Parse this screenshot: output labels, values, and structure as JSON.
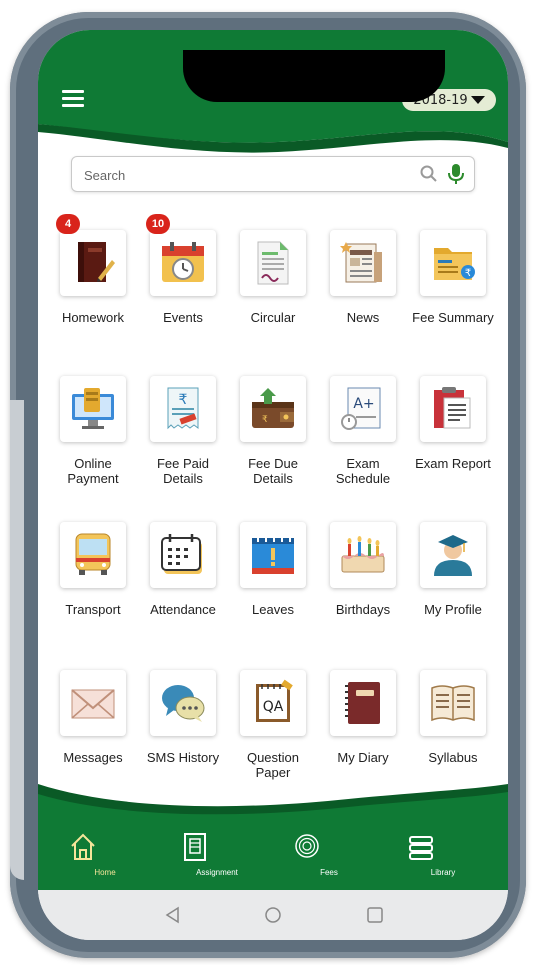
{
  "header": {
    "year": "2018-19"
  },
  "search": {
    "placeholder": "Search"
  },
  "tiles": [
    {
      "label": "Homework",
      "badge": "4",
      "icon": "homework-book-icon"
    },
    {
      "label": "Events",
      "badge": "10",
      "icon": "calendar-clock-icon"
    },
    {
      "label": "Circular",
      "icon": "circular-document-icon"
    },
    {
      "label": "News",
      "icon": "newspaper-icon"
    },
    {
      "label": "Fee Summary",
      "icon": "fee-summary-icon"
    },
    {
      "label": "Online\nPayment",
      "icon": "online-payment-icon"
    },
    {
      "label": "Fee Paid\nDetails",
      "icon": "rupee-receipt-icon"
    },
    {
      "label": "Fee Due\nDetails",
      "icon": "wallet-icon"
    },
    {
      "label": "Exam\nSchedule",
      "icon": "exam-grade-icon",
      "grade": "A+"
    },
    {
      "label": "Exam Report",
      "icon": "clipboard-report-icon"
    },
    {
      "label": "Transport",
      "icon": "bus-icon"
    },
    {
      "label": "Attendance",
      "icon": "attendance-calendar-icon"
    },
    {
      "label": "Leaves",
      "icon": "leave-calendar-icon"
    },
    {
      "label": "Birthdays",
      "icon": "birthday-cake-icon"
    },
    {
      "label": "My Profile",
      "icon": "graduate-profile-icon"
    },
    {
      "label": "Messages",
      "icon": "envelope-icon"
    },
    {
      "label": "SMS History",
      "icon": "chat-bubbles-icon"
    },
    {
      "label": "Question\nPaper",
      "icon": "question-paper-icon",
      "qa": "QA"
    },
    {
      "label": "My Diary",
      "icon": "diary-icon"
    },
    {
      "label": "Syllabus",
      "icon": "open-book-icon"
    }
  ],
  "bottom_nav": [
    {
      "label": "Home",
      "icon": "home-icon",
      "active": true
    },
    {
      "label": "Assignment",
      "icon": "assignment-icon"
    },
    {
      "label": "Fees",
      "icon": "fees-icon"
    },
    {
      "label": "Library",
      "icon": "library-icon"
    }
  ],
  "colors": {
    "brand_green": "#0f7a35",
    "dark_green": "#0a5a26",
    "badge_red": "#d9241b",
    "active_nav": "#f5e59a"
  }
}
